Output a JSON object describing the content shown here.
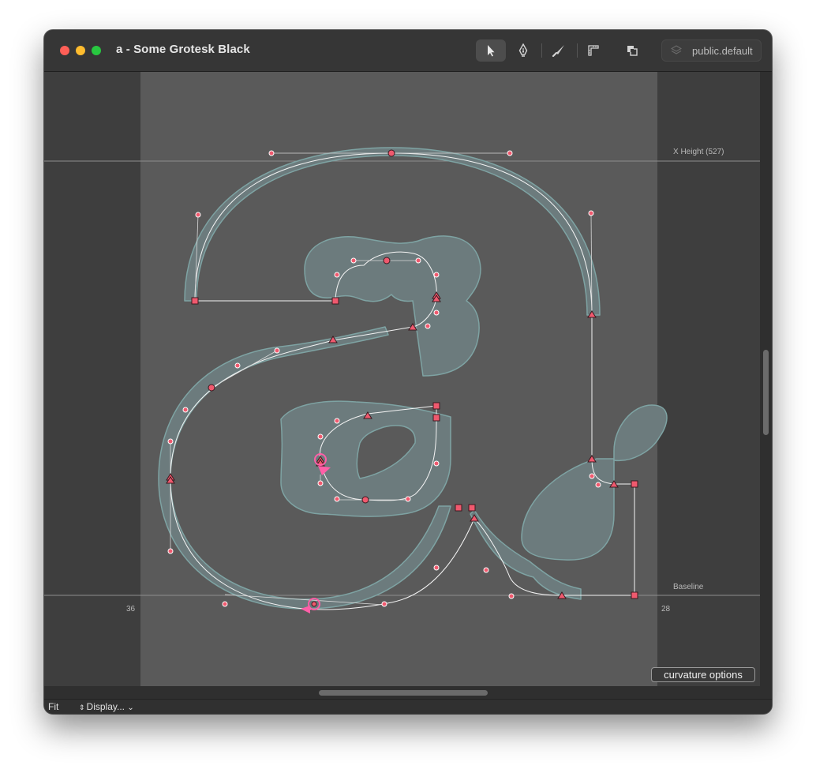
{
  "window": {
    "title": "a - Some Grotesk Black",
    "layer": "public.default"
  },
  "toolbar": {
    "tools": [
      {
        "name": "pointer-tool",
        "icon": "arrow-pointer-icon",
        "active": true
      },
      {
        "name": "pen-tool",
        "icon": "pen-nib-icon",
        "active": false
      },
      {
        "name": "knife-tool",
        "icon": "knife-icon",
        "active": false
      },
      {
        "name": "ruler-tool",
        "icon": "ruler-icon",
        "active": false
      },
      {
        "name": "shapes-tool",
        "icon": "overlap-squares-icon",
        "active": false
      }
    ]
  },
  "canvas": {
    "metrics": {
      "x_height_label": "X Height (527)",
      "baseline_label": "Baseline",
      "left_sidebearing": "36",
      "right_sidebearing": "28"
    },
    "curvature_button": "curvature options",
    "colors": {
      "background": "#3e3e3e",
      "glyph_area": "#5a5a5a",
      "glyph_fill": "#6c7b7d",
      "glyph_stroke": "#7ea3a3",
      "point": "#f0596e",
      "selection": "#ff5fa7"
    }
  },
  "statusbar": {
    "zoom": "Fit",
    "display": "Display..."
  }
}
